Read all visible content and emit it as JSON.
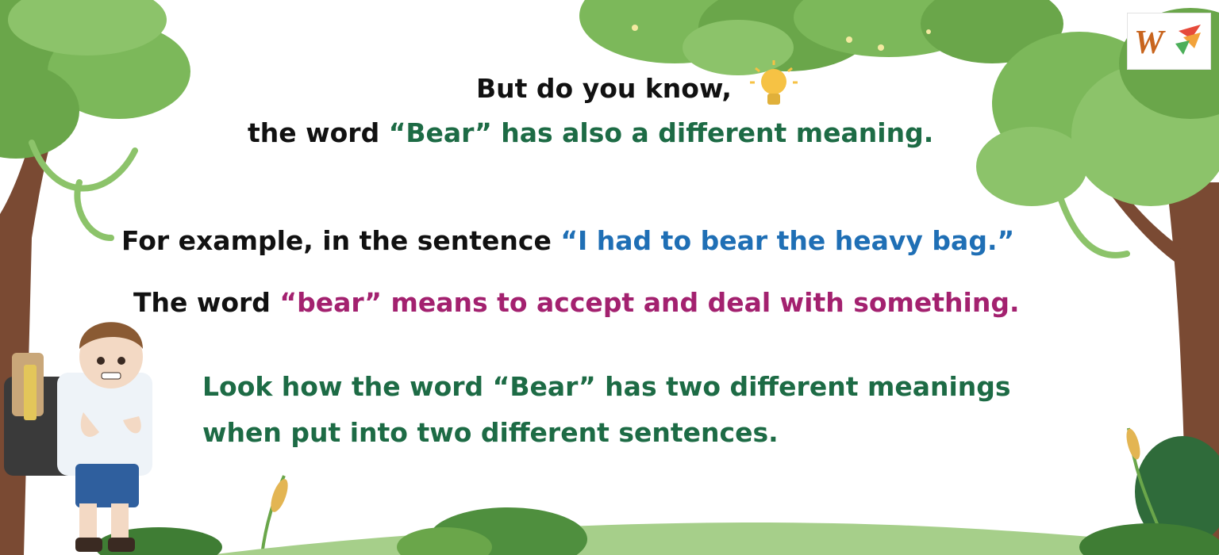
{
  "intro": {
    "line1": "But do you know,",
    "line2_prefix": "the word ",
    "line2_highlight": "“Bear” has also a different meaning."
  },
  "example": {
    "prefix": "For example, in the sentence ",
    "sentence": "“I had to bear the heavy bag.”"
  },
  "meaning": {
    "prefix": "The word ",
    "highlight": "“bear” means to accept and deal with something."
  },
  "conclusion": {
    "line1": "Look how the word “Bear” has two different meanings",
    "line2": "when put into two different sentences."
  },
  "logo": {
    "letter": "W"
  },
  "icons": [
    "lightbulb-icon",
    "tree-left",
    "tree-right",
    "schoolboy-with-backpack",
    "cattail-plants",
    "grass-hill"
  ],
  "colors": {
    "text": "#111111",
    "green_text": "#1d6b45",
    "blue_text": "#1f6fb5",
    "magenta_text": "#a3216f",
    "foliage": "#6fa84f",
    "trunk": "#7a4a33",
    "bulb": "#f6c244"
  }
}
